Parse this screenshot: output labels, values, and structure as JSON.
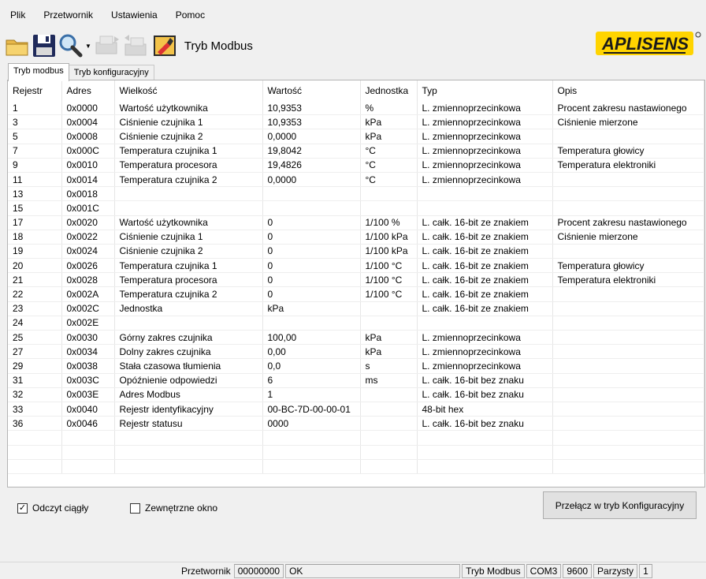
{
  "menu": [
    "Plik",
    "Przetwornik",
    "Ustawienia",
    "Pomoc"
  ],
  "toolbar": {
    "title": "Tryb Modbus"
  },
  "logo": {
    "text": "APLISENS"
  },
  "tabs": [
    "Tryb modbus",
    "Tryb konfiguracyjny"
  ],
  "table": {
    "columns": [
      "Rejestr",
      "Adres",
      "Wielkość",
      "Wartość",
      "Jednostka",
      "Typ",
      "Opis"
    ],
    "rows": [
      [
        "1",
        "0x0000",
        "Wartość użytkownika",
        "10,9353",
        "%",
        "L. zmiennoprzecinkowa",
        "Procent zakresu nastawionego"
      ],
      [
        "3",
        "0x0004",
        "Ciśnienie czujnika 1",
        "10,9353",
        "kPa",
        "L. zmiennoprzecinkowa",
        "Ciśnienie mierzone"
      ],
      [
        "5",
        "0x0008",
        "Ciśnienie czujnika 2",
        "0,0000",
        "kPa",
        "L. zmiennoprzecinkowa",
        ""
      ],
      [
        "7",
        "0x000C",
        "Temperatura czujnika 1",
        "19,8042",
        "°C",
        "L. zmiennoprzecinkowa",
        "Temperatura głowicy"
      ],
      [
        "9",
        "0x0010",
        "Temperatura procesora",
        "19,4826",
        "°C",
        "L. zmiennoprzecinkowa",
        "Temperatura elektroniki"
      ],
      [
        "11",
        "0x0014",
        "Temperatura czujnika 2",
        "0,0000",
        "°C",
        "L. zmiennoprzecinkowa",
        ""
      ],
      [
        "13",
        "0x0018",
        "",
        "",
        "",
        "",
        ""
      ],
      [
        "15",
        "0x001C",
        "",
        "",
        "",
        "",
        ""
      ],
      [
        "17",
        "0x0020",
        "Wartość użytkownika",
        "0",
        "1/100 %",
        "L. całk. 16-bit ze znakiem",
        "Procent zakresu nastawionego"
      ],
      [
        "18",
        "0x0022",
        "Ciśnienie czujnika 1",
        "0",
        "1/100 kPa",
        "L. całk. 16-bit ze znakiem",
        "Ciśnienie mierzone"
      ],
      [
        "19",
        "0x0024",
        "Ciśnienie czujnika 2",
        "0",
        "1/100 kPa",
        "L. całk. 16-bit ze znakiem",
        ""
      ],
      [
        "20",
        "0x0026",
        "Temperatura czujnika 1",
        "0",
        "1/100 °C",
        "L. całk. 16-bit ze znakiem",
        "Temperatura głowicy"
      ],
      [
        "21",
        "0x0028",
        "Temperatura procesora",
        "0",
        "1/100 °C",
        "L. całk. 16-bit ze znakiem",
        "Temperatura elektroniki"
      ],
      [
        "22",
        "0x002A",
        "Temperatura czujnika 2",
        "0",
        "1/100 °C",
        "L. całk. 16-bit ze znakiem",
        ""
      ],
      [
        "23",
        "0x002C",
        "Jednostka",
        "kPa",
        "",
        "L. całk. 16-bit ze znakiem",
        ""
      ],
      [
        "24",
        "0x002E",
        "",
        "",
        "",
        "",
        ""
      ],
      [
        "25",
        "0x0030",
        "Górny zakres czujnika",
        "100,00",
        "kPa",
        "L. zmiennoprzecinkowa",
        ""
      ],
      [
        "27",
        "0x0034",
        "Dolny zakres czujnika",
        "0,00",
        "kPa",
        "L. zmiennoprzecinkowa",
        ""
      ],
      [
        "29",
        "0x0038",
        "Stała czasowa tłumienia",
        "0,0",
        "s",
        "L. zmiennoprzecinkowa",
        ""
      ],
      [
        "31",
        "0x003C",
        "Opóźnienie odpowiedzi",
        "6",
        "ms",
        "L. całk. 16-bit bez znaku",
        ""
      ],
      [
        "32",
        "0x003E",
        "Adres Modbus",
        "1",
        "",
        "L. całk. 16-bit bez znaku",
        ""
      ],
      [
        "33",
        "0x0040",
        "Rejestr identyfikacyjny",
        "00-BC-7D-00-00-01",
        "",
        "48-bit hex",
        ""
      ],
      [
        "36",
        "0x0046",
        "Rejestr statusu",
        "0000",
        "",
        "L. całk. 16-bit bez znaku",
        ""
      ]
    ]
  },
  "options": {
    "continuous": {
      "label": "Odczyt ciągły",
      "checked": true
    },
    "external": {
      "label": "Zewnętrzne okno",
      "checked": false
    }
  },
  "switch_button": "Przełącz w tryb Konfiguracyjny",
  "status": {
    "label": "Przetwornik",
    "serial": "00000000",
    "state": "OK",
    "mode": "Tryb Modbus",
    "port": "COM3",
    "baud": "9600",
    "parity": "Parzysty",
    "stop": "1"
  }
}
